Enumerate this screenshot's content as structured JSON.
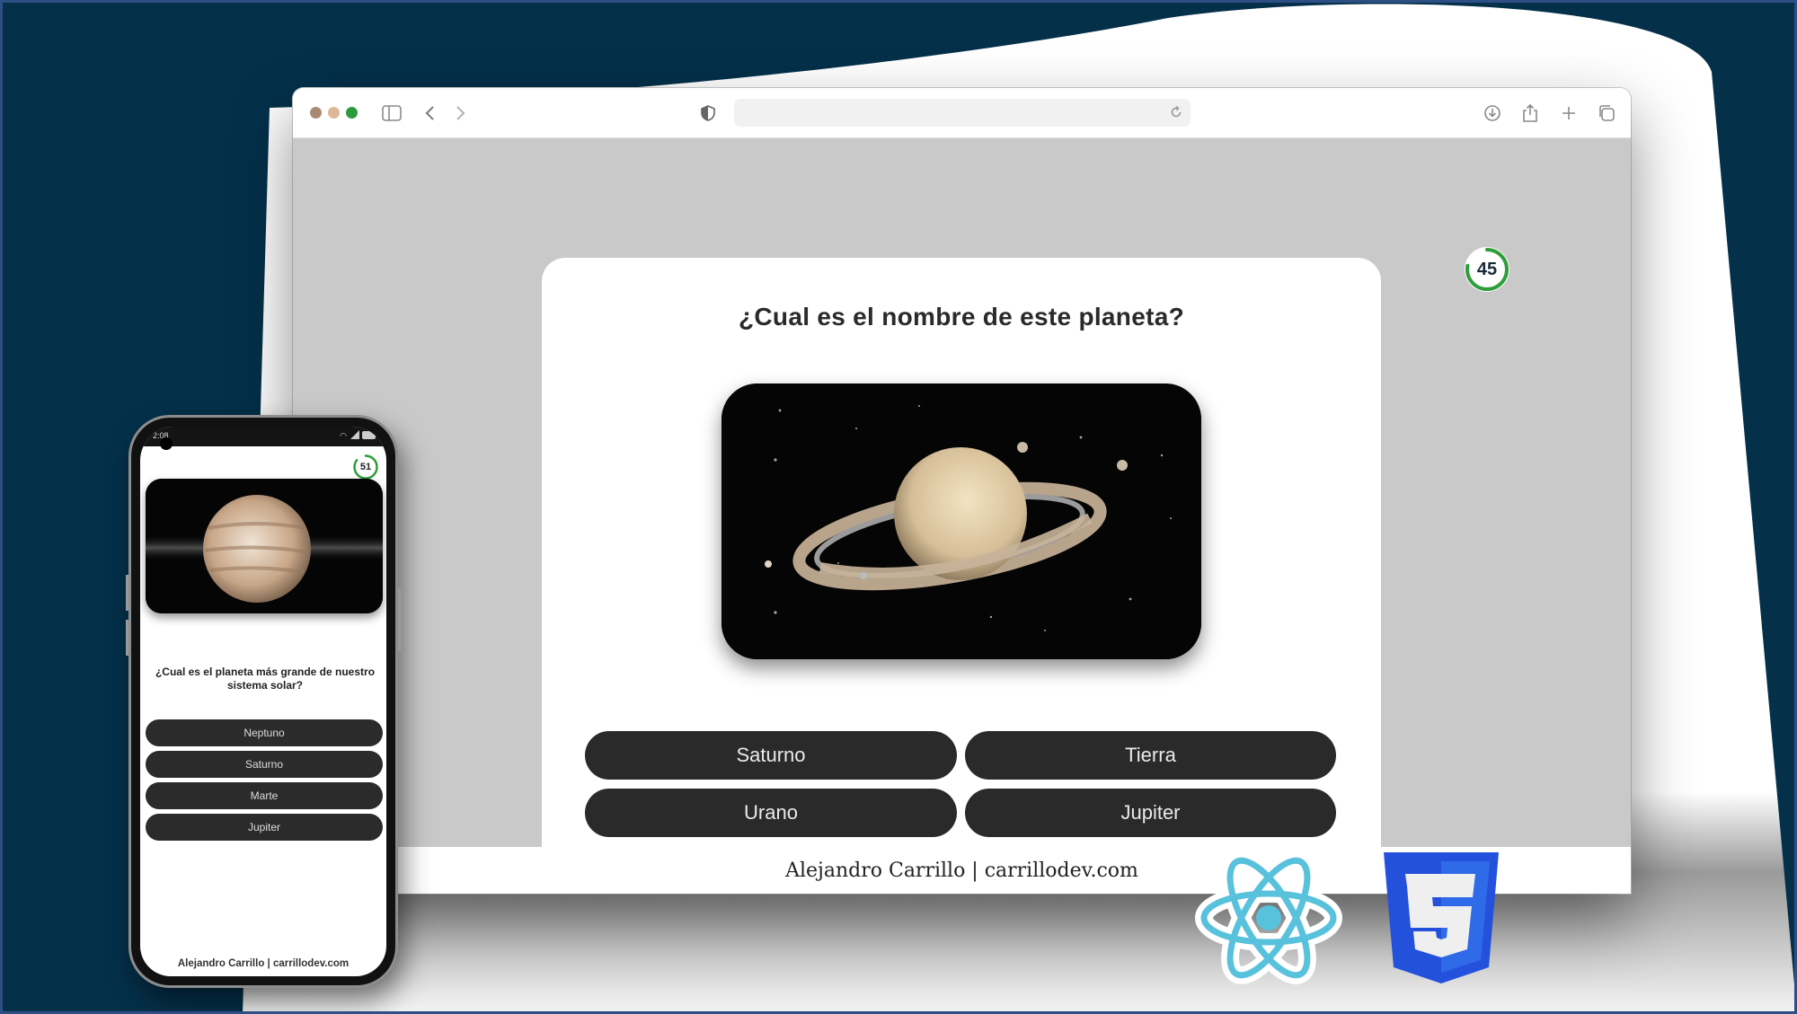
{
  "browser": {
    "window_controls": [
      "close",
      "minimize",
      "maximize"
    ],
    "traffic_light_colors": {
      "close": "#a88a72",
      "minimize": "#ddb896",
      "maximize": "#2a9b3c"
    },
    "toolbar_icons": [
      "sidebar-icon",
      "back-icon",
      "forward-icon",
      "shield-icon",
      "reload-icon",
      "download-icon",
      "share-icon",
      "new-tab-icon",
      "tabs-overview-icon"
    ],
    "address": ""
  },
  "quiz": {
    "timer": {
      "value": "45",
      "progress": 0.78,
      "color": "#2f9e3a"
    },
    "question": "¿Cual es el nombre de este planeta?",
    "image_subject": "Saturno",
    "answers": [
      "Saturno",
      "Tierra",
      "Urano",
      "Jupiter"
    ],
    "footer": "Alejandro Carrillo | carrillodev.com"
  },
  "phone": {
    "status_time": "2:08",
    "timer": {
      "value": "51",
      "progress": 0.85
    },
    "image_subject": "Jupiter",
    "question": "¿Cual es el planeta más grande de nuestro sistema solar?",
    "answers": [
      "Neptuno",
      "Saturno",
      "Marte",
      "Jupiter"
    ],
    "footer": "Alejandro Carrillo | carrillodev.com"
  },
  "logos": [
    "react-logo",
    "css3-logo"
  ],
  "colors": {
    "background": "#04304a",
    "button": "#2a2a2a",
    "page_gray": "#c9c9c9",
    "react": "#58c1dc",
    "css3": "#2563e6"
  }
}
